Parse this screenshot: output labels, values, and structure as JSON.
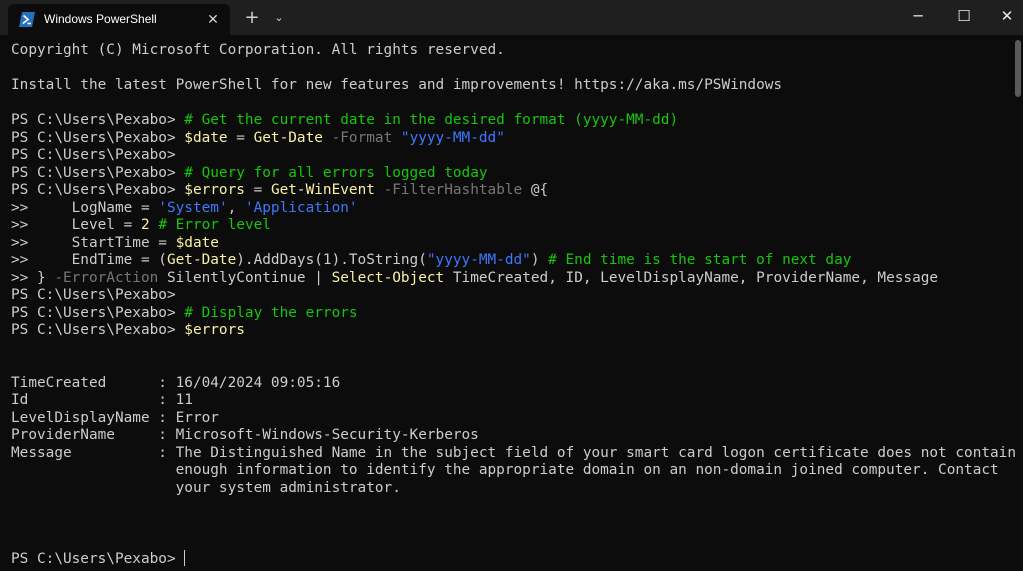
{
  "window": {
    "tab_title": "Windows PowerShell",
    "tab_close": "✕",
    "new_tab": "+",
    "tab_menu": "⌄",
    "minimize": "─",
    "maximize": "☐",
    "close": "✕"
  },
  "colors": {
    "background": "#0c0c0c",
    "titlebar": "#1f1f1f",
    "text": "#cccccc",
    "comment": "#16c60c",
    "command": "#f9f1a5",
    "parameter": "#767676",
    "string": "#3b78ff"
  },
  "terminal": {
    "lines": [
      [
        {
          "t": "Copyright (C) Microsoft Corporation. All rights reserved.",
          "c": "c-prompt"
        }
      ],
      [],
      [
        {
          "t": "Install the latest PowerShell for new features and improvements! https://aka.ms/PSWindows",
          "c": "c-prompt"
        }
      ],
      [],
      [
        {
          "t": "PS C:\\Users\\Pexabo> ",
          "c": "c-prompt"
        },
        {
          "t": "# Get the current date in the desired format (yyyy-MM-dd)",
          "c": "c-comment"
        }
      ],
      [
        {
          "t": "PS C:\\Users\\Pexabo> ",
          "c": "c-prompt"
        },
        {
          "t": "$date",
          "c": "c-var"
        },
        {
          "t": " = ",
          "c": "c-op"
        },
        {
          "t": "Get-Date",
          "c": "c-cmd"
        },
        {
          "t": " -Format ",
          "c": "c-param"
        },
        {
          "t": "\"yyyy-MM-dd\"",
          "c": "c-str"
        }
      ],
      [
        {
          "t": "PS C:\\Users\\Pexabo>",
          "c": "c-prompt"
        }
      ],
      [
        {
          "t": "PS C:\\Users\\Pexabo> ",
          "c": "c-prompt"
        },
        {
          "t": "# Query for all errors logged today",
          "c": "c-comment"
        }
      ],
      [
        {
          "t": "PS C:\\Users\\Pexabo> ",
          "c": "c-prompt"
        },
        {
          "t": "$errors",
          "c": "c-var"
        },
        {
          "t": " = ",
          "c": "c-op"
        },
        {
          "t": "Get-WinEvent",
          "c": "c-cmd"
        },
        {
          "t": " -FilterHashtable ",
          "c": "c-param"
        },
        {
          "t": "@{",
          "c": "c-op"
        }
      ],
      [
        {
          "t": ">>     LogName = ",
          "c": "c-prompt"
        },
        {
          "t": "'System'",
          "c": "c-str"
        },
        {
          "t": ", ",
          "c": "c-op"
        },
        {
          "t": "'Application'",
          "c": "c-str"
        }
      ],
      [
        {
          "t": ">>     Level = ",
          "c": "c-prompt"
        },
        {
          "t": "2",
          "c": "c-num"
        },
        {
          "t": " ",
          "c": "c-op"
        },
        {
          "t": "# Error level",
          "c": "c-comment"
        }
      ],
      [
        {
          "t": ">>     StartTime = ",
          "c": "c-prompt"
        },
        {
          "t": "$date",
          "c": "c-var"
        }
      ],
      [
        {
          "t": ">>     EndTime = (",
          "c": "c-prompt"
        },
        {
          "t": "Get-Date",
          "c": "c-cmd"
        },
        {
          "t": ").AddDays(1).ToString(",
          "c": "c-op"
        },
        {
          "t": "\"yyyy-MM-dd\"",
          "c": "c-str"
        },
        {
          "t": ") ",
          "c": "c-op"
        },
        {
          "t": "# End time is the start of next day",
          "c": "c-comment"
        }
      ],
      [
        {
          "t": ">> } ",
          "c": "c-prompt"
        },
        {
          "t": "-ErrorAction ",
          "c": "c-param"
        },
        {
          "t": "SilentlyContinue | ",
          "c": "c-op"
        },
        {
          "t": "Select-Object",
          "c": "c-cmd"
        },
        {
          "t": " TimeCreated, ID, LevelDisplayName, ProviderName, Message",
          "c": "c-op"
        }
      ],
      [
        {
          "t": "PS C:\\Users\\Pexabo>",
          "c": "c-prompt"
        }
      ],
      [
        {
          "t": "PS C:\\Users\\Pexabo> ",
          "c": "c-prompt"
        },
        {
          "t": "# Display the errors",
          "c": "c-comment"
        }
      ],
      [
        {
          "t": "PS C:\\Users\\Pexabo> ",
          "c": "c-prompt"
        },
        {
          "t": "$errors",
          "c": "c-var"
        }
      ],
      [],
      [],
      [
        {
          "t": "TimeCreated      : 16/04/2024 09:05:16",
          "c": "c-prompt"
        }
      ],
      [
        {
          "t": "Id               : 11",
          "c": "c-prompt"
        }
      ],
      [
        {
          "t": "LevelDisplayName : Error",
          "c": "c-prompt"
        }
      ],
      [
        {
          "t": "ProviderName     : Microsoft-Windows-Security-Kerberos",
          "c": "c-prompt"
        }
      ],
      [
        {
          "t": "Message          : The Distinguished Name in the subject field of your smart card logon certificate does not contain",
          "c": "c-prompt"
        }
      ],
      [
        {
          "t": "                   enough information to identify the appropriate domain on an non-domain joined computer. Contact",
          "c": "c-prompt"
        }
      ],
      [
        {
          "t": "                   your system administrator.",
          "c": "c-prompt"
        }
      ],
      [],
      [],
      [],
      [
        {
          "t": "PS C:\\Users\\Pexabo> ",
          "c": "c-prompt"
        }
      ]
    ]
  }
}
